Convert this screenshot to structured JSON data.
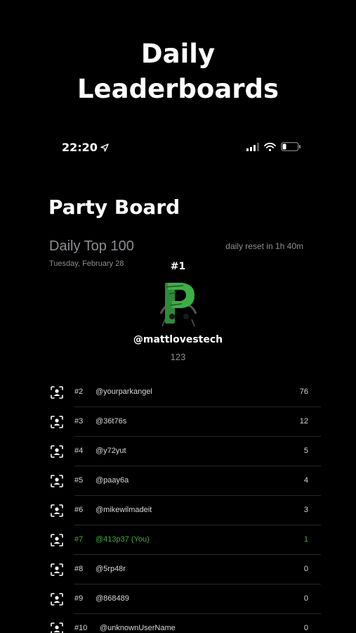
{
  "headline": "Daily\nLeaderboards",
  "status_bar": {
    "time": "22:20",
    "location_icon": "location-arrow-icon",
    "signal_icon": "cellular-signal-icon",
    "wifi_icon": "wifi-icon",
    "battery_icon": "battery-icon",
    "battery_level_fraction": 0.25
  },
  "board_title": "Party Board",
  "section_title": "Daily Top 100",
  "reset_text": "daily reset in 1h 40m",
  "date_text": "Tuesday, February 28",
  "winner": {
    "rank": "#1",
    "username": "@mattlovestech",
    "score": "123",
    "avatar_icon": "green-p-logo-avatar"
  },
  "colors": {
    "background": "#000000",
    "accent_you": "#3cb043",
    "muted": "#8e8e93"
  },
  "entries": [
    {
      "rank": "#2",
      "username": "@yourparkangel",
      "score": "76",
      "is_you": false
    },
    {
      "rank": "#3",
      "username": "@36t76s",
      "score": "12",
      "is_you": false
    },
    {
      "rank": "#4",
      "username": "@y72yut",
      "score": "5",
      "is_you": false
    },
    {
      "rank": "#5",
      "username": "@paay6a",
      "score": "4",
      "is_you": false
    },
    {
      "rank": "#6",
      "username": "@mikewilmadeit",
      "score": "3",
      "is_you": false
    },
    {
      "rank": "#7",
      "username": "@413p37 (You)",
      "score": "1",
      "is_you": true
    },
    {
      "rank": "#8",
      "username": "@5rp48r",
      "score": "0",
      "is_you": false
    },
    {
      "rank": "#9",
      "username": "@868489",
      "score": "0",
      "is_you": false
    },
    {
      "rank": "#10",
      "username": "@unknownUserName",
      "score": "0",
      "is_you": false
    }
  ]
}
